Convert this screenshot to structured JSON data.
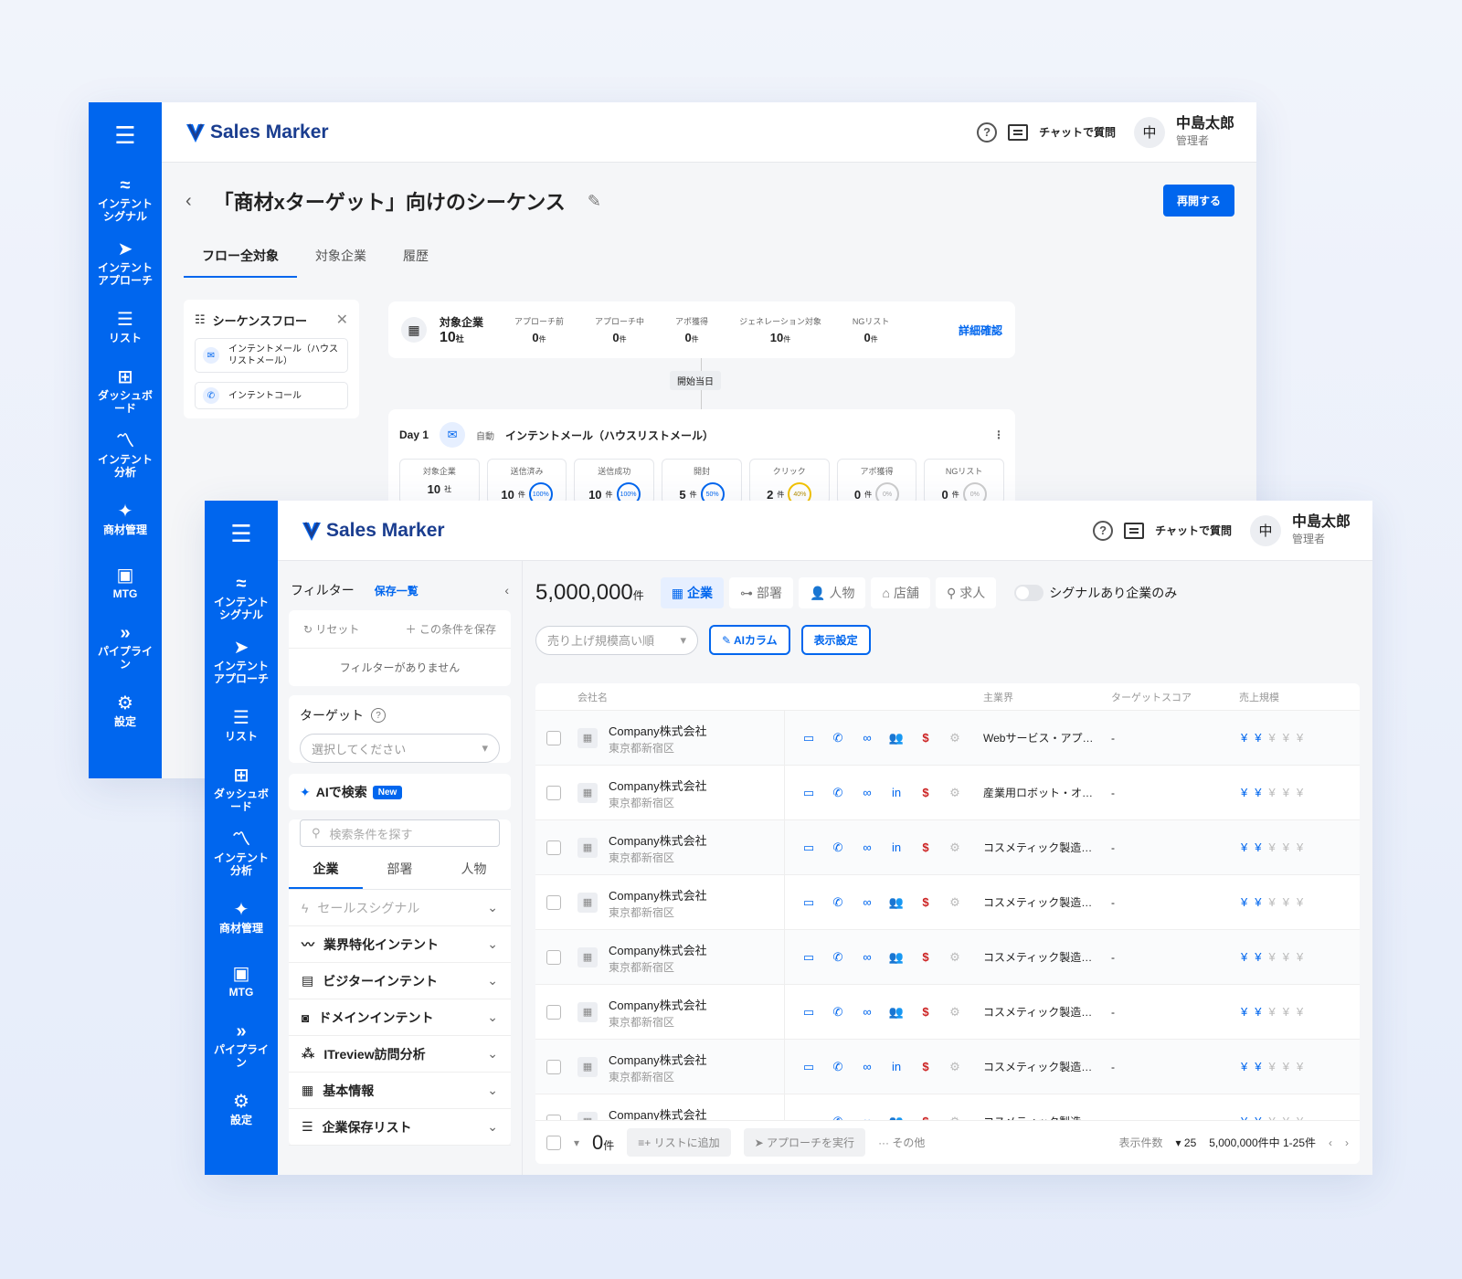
{
  "logo_text": "Sales Marker",
  "header": {
    "chat_label": "チャットで質問",
    "avatar_initial": "中",
    "user_name": "中島太郎",
    "user_role": "管理者",
    "help_label": "?"
  },
  "sidebar_w1": [
    {
      "icon": "≈",
      "label": "インテントシグナル"
    },
    {
      "icon": "➤",
      "label": "インテントアプローチ"
    },
    {
      "icon": "☰",
      "label": "リスト"
    },
    {
      "icon": "⊞",
      "label": "ダッシュボード"
    },
    {
      "icon": "〽",
      "label": "インテント分析"
    },
    {
      "icon": "✦",
      "label": "商材管理"
    },
    {
      "icon": "▣",
      "label": "MTG"
    },
    {
      "icon": "»",
      "label": "パイプライン"
    },
    {
      "icon": "⚙",
      "label": "設定"
    }
  ],
  "sidebar_w2": [
    {
      "icon": "≈",
      "label": "インテントシグナル"
    },
    {
      "icon": "➤",
      "label": "インテントアプローチ"
    },
    {
      "icon": "☰",
      "label": "リスト"
    },
    {
      "icon": "⊞",
      "label": "ダッシュボード"
    },
    {
      "icon": "〽",
      "label": "インテント分析"
    },
    {
      "icon": "✦",
      "label": "商材管理"
    },
    {
      "icon": "▣",
      "label": "MTG"
    },
    {
      "icon": "»",
      "label": "パイプライン"
    },
    {
      "icon": "⚙",
      "label": "設定"
    }
  ],
  "sequence": {
    "title": "「商材xターゲット」向けのシーケンス",
    "resume_label": "再開する",
    "tabs": [
      "フロー全対象",
      "対象企業",
      "履歴"
    ],
    "flow_title": "シーケンスフロー",
    "flow_items": [
      "インテントメール（ハウスリストメール）",
      "インテントコール"
    ],
    "summary": {
      "label": "対象企業",
      "value": "10",
      "unit": "社",
      "stats": [
        {
          "label": "アプローチ前",
          "value": "0",
          "unit": "件"
        },
        {
          "label": "アプローチ中",
          "value": "0",
          "unit": "件"
        },
        {
          "label": "アポ獲得",
          "value": "0",
          "unit": "件"
        },
        {
          "label": "ジェネレーション対象",
          "value": "10",
          "unit": "件"
        },
        {
          "label": "NGリスト",
          "value": "0",
          "unit": "件"
        }
      ],
      "detail_label": "詳細確認"
    },
    "start_badge": "開始当日",
    "day": {
      "label": "Day 1",
      "auto": "自動",
      "title": "インテントメール（ハウスリストメール）",
      "stats": [
        {
          "label": "対象企業",
          "value": "10",
          "unit": "社",
          "pct": ""
        },
        {
          "label": "送信済み",
          "value": "10",
          "unit": "件",
          "pct": "100%"
        },
        {
          "label": "送信成功",
          "value": "10",
          "unit": "件",
          "pct": "100%"
        },
        {
          "label": "開封",
          "value": "5",
          "unit": "件",
          "pct": "50%"
        },
        {
          "label": "クリック",
          "value": "2",
          "unit": "件",
          "pct": "40%"
        },
        {
          "label": "アポ獲得",
          "value": "0",
          "unit": "件",
          "pct": "0%"
        },
        {
          "label": "NGリスト",
          "value": "0",
          "unit": "件",
          "pct": "0%"
        }
      ]
    }
  },
  "filter": {
    "title": "フィルター",
    "saved_label": "保存一覧",
    "reset_label": "リセット",
    "save_label": "この条件を保存",
    "none_label": "フィルターがありません",
    "target_label": "ターゲット",
    "target_placeholder": "選択してください",
    "ai_label": "AIで検索",
    "new_badge": "New",
    "search_placeholder": "検索条件を探す",
    "tabs": [
      "企業",
      "部署",
      "人物"
    ],
    "categories": [
      {
        "icon": "ϟ",
        "label": "セールスシグナル",
        "disabled": true
      },
      {
        "icon": "〰",
        "label": "業界特化インテント"
      },
      {
        "icon": "▤",
        "label": "ビジターインテント"
      },
      {
        "icon": "◙",
        "label": "ドメインインテント"
      },
      {
        "icon": "⁂",
        "label": "ITreview訪問分析"
      },
      {
        "icon": "▦",
        "label": "基本情報"
      },
      {
        "icon": "☰",
        "label": "企業保存リスト"
      }
    ]
  },
  "search_results": {
    "count": "5,000,000",
    "count_unit": "件",
    "entity_tabs": [
      "企業",
      "部署",
      "人物",
      "店舗",
      "求人"
    ],
    "signal_toggle_label": "シグナルあり企業のみ",
    "sort_label": "売り上げ規模高い順",
    "ai_column_label": "AIカラム",
    "display_settings_label": "表示設定",
    "columns": {
      "company": "会社名",
      "industry": "主業界",
      "score": "ターゲットスコア",
      "revenue": "売上規模"
    },
    "rows": [
      {
        "name": "Company株式会社",
        "location": "東京都新宿区",
        "social": "people",
        "industry": "Webサービス・アプ…",
        "score": "-",
        "revenue_level": 2
      },
      {
        "name": "Company株式会社",
        "location": "東京都新宿区",
        "social": "linkedin",
        "industry": "産業用ロボット・オ…",
        "score": "-",
        "revenue_level": 2
      },
      {
        "name": "Company株式会社",
        "location": "東京都新宿区",
        "social": "linkedin",
        "industry": "コスメティック製造…",
        "score": "-",
        "revenue_level": 2
      },
      {
        "name": "Company株式会社",
        "location": "東京都新宿区",
        "social": "people",
        "industry": "コスメティック製造…",
        "score": "-",
        "revenue_level": 2
      },
      {
        "name": "Company株式会社",
        "location": "東京都新宿区",
        "social": "people",
        "industry": "コスメティック製造…",
        "score": "-",
        "revenue_level": 2
      },
      {
        "name": "Company株式会社",
        "location": "東京都新宿区",
        "social": "people",
        "industry": "コスメティック製造…",
        "score": "-",
        "revenue_level": 2
      },
      {
        "name": "Company株式会社",
        "location": "東京都新宿区",
        "social": "linkedin",
        "industry": "コスメティック製造…",
        "score": "-",
        "revenue_level": 2
      },
      {
        "name": "Company株式会社",
        "location": "東京都新宿区",
        "social": "people",
        "industry": "コスメティック製造…",
        "score": "-",
        "revenue_level": 2
      }
    ],
    "footer": {
      "selected": "0",
      "selected_unit": "件",
      "add_list": "リストに追加",
      "approach": "アプローチを実行",
      "more": "その他",
      "per_page_label": "表示件数",
      "per_page": "25",
      "range": "5,000,000件中 1-25件"
    }
  },
  "colors": {
    "primary": "#0066ee"
  }
}
